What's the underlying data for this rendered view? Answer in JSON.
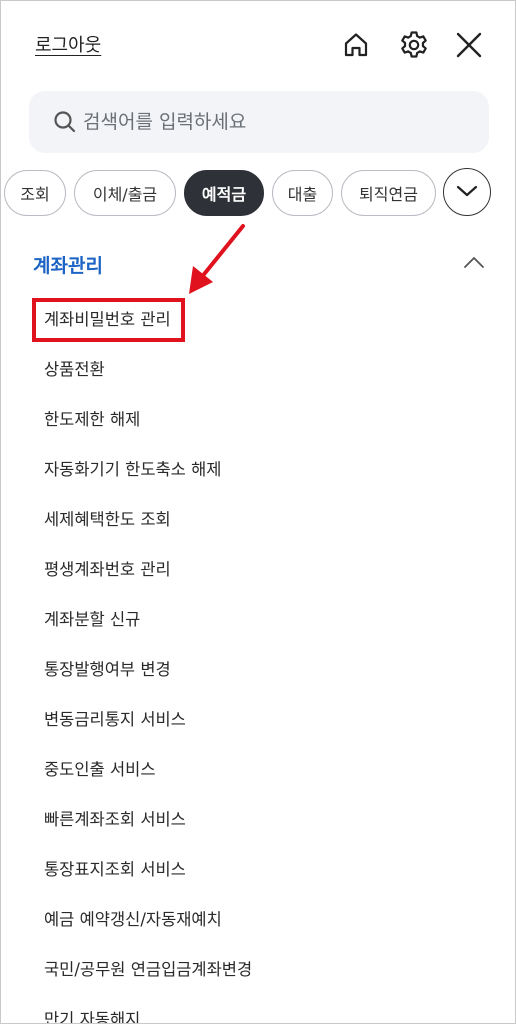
{
  "header": {
    "logout_label": "로그아웃",
    "icons": [
      "home-icon",
      "gear-icon",
      "close-icon"
    ]
  },
  "search": {
    "placeholder": "검색어를 입력하세요",
    "value": ""
  },
  "tabs": [
    {
      "label": "조회",
      "active": false
    },
    {
      "label": "이체/출금",
      "active": false
    },
    {
      "label": "예적금",
      "active": true
    },
    {
      "label": "대출",
      "active": false
    },
    {
      "label": "퇴직연금",
      "active": false
    }
  ],
  "section": {
    "title": "계좌관리",
    "expanded": true,
    "items": [
      {
        "label": "계좌비밀번호 관리",
        "highlighted": true
      },
      {
        "label": "상품전환"
      },
      {
        "label": "한도제한 해제"
      },
      {
        "label": "자동화기기 한도축소 해제"
      },
      {
        "label": "세제혜택한도 조회"
      },
      {
        "label": "평생계좌번호 관리"
      },
      {
        "label": "계좌분할 신규"
      },
      {
        "label": "통장발행여부 변경"
      },
      {
        "label": "변동금리통지 서비스"
      },
      {
        "label": "중도인출 서비스"
      },
      {
        "label": "빠른계좌조회 서비스"
      },
      {
        "label": "통장표지조회 서비스"
      },
      {
        "label": "예금 예약갱신/자동재예치"
      },
      {
        "label": "국민/공무원 연금입금계좌변경"
      },
      {
        "label": "만기 자동해지"
      }
    ]
  },
  "colors": {
    "accent_blue": "#1b63c4",
    "active_tab": "#2e3137",
    "search_bg": "#f2f4f7",
    "annotation_red": "#e0121e"
  }
}
